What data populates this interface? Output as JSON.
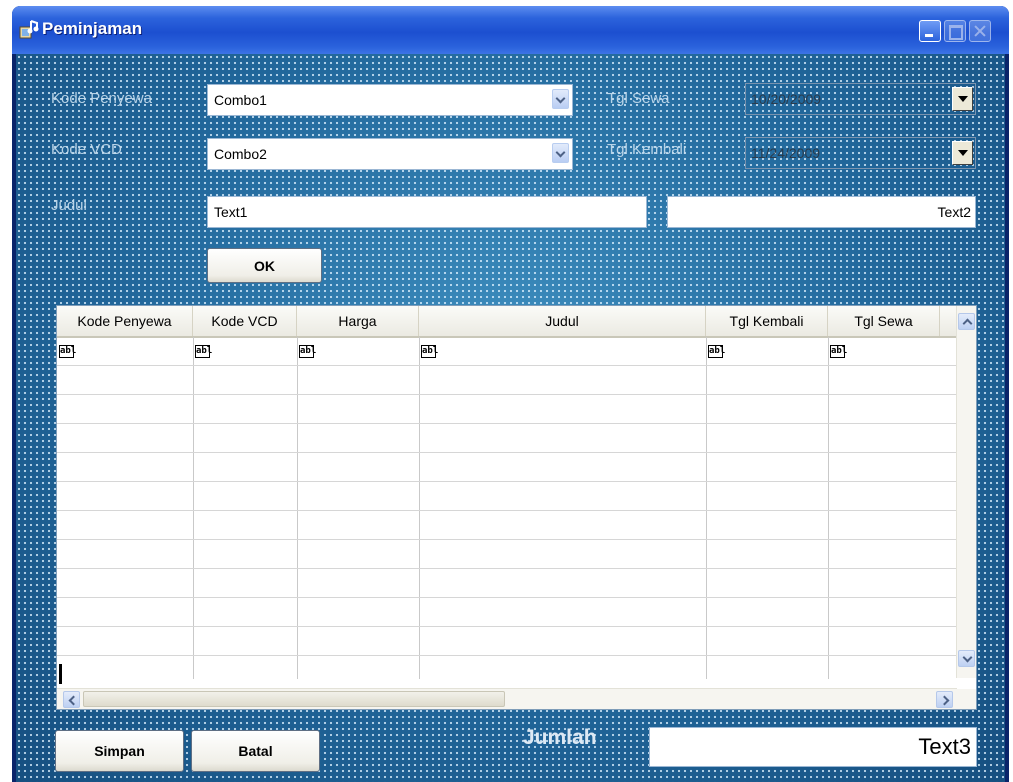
{
  "window": {
    "title": "Peminjaman"
  },
  "form": {
    "kode_penyewa_label": "Kode Penyewa",
    "kode_vcd_label": "Kode VCD",
    "judul_label": "Judul",
    "tgl_sewa_label": "Tgl Sewa",
    "tgl_kembali_label": "Tgl Kembali",
    "combo1_value": "Combo1",
    "combo2_value": "Combo2",
    "tgl_sewa_value": "10/20/2009",
    "tgl_kembali_value": "11/24/2009",
    "text1_value": "Text1",
    "text2_value": "Text2",
    "ok_label": "OK"
  },
  "grid": {
    "columns": [
      "Kode Penyewa",
      "Kode VCD",
      "Harga",
      "Judul",
      "Tgl Kembali",
      "Tgl Sewa"
    ],
    "cell_icon": "abl"
  },
  "footer": {
    "simpan_label": "Simpan",
    "batal_label": "Batal",
    "jumlah_label": "Jumlah",
    "text3_value": "Text3"
  },
  "colors": {
    "titlebar": "#2c63dc",
    "form_background": "#1f6698"
  },
  "icons": [
    "app-icon",
    "minimize-icon",
    "maximize-icon",
    "close-icon",
    "dropdown-arrow-icon",
    "scroll-up-icon",
    "scroll-down-icon",
    "scroll-left-icon",
    "scroll-right-icon",
    "textbox-icon"
  ]
}
